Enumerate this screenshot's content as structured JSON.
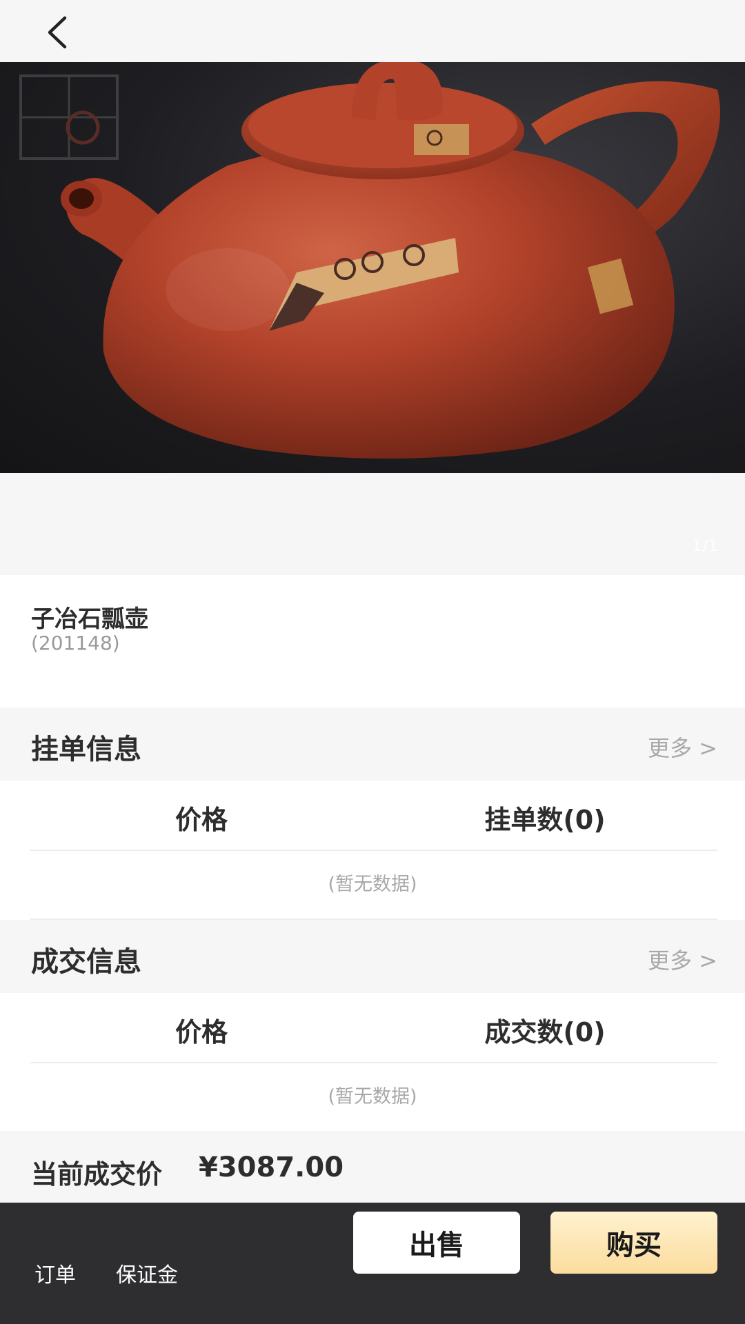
{
  "nav": {
    "back_icon": "chevron-left-icon"
  },
  "gallery": {
    "pager": "1/1",
    "image_subject": "teapot-photo"
  },
  "product": {
    "name": "子冶石瓢壶",
    "code": "(201148)"
  },
  "listing": {
    "title": "挂单信息",
    "more": "更多 >",
    "col_price": "价格",
    "col_count": "挂单数(0)",
    "empty": "(暂无数据)"
  },
  "deals": {
    "title": "成交信息",
    "more": "更多 >",
    "col_price": "价格",
    "col_count": "成交数(0)",
    "empty": "(暂无数据)"
  },
  "current": {
    "label": "当前成交价",
    "value": "¥3087.00"
  },
  "bottom": {
    "orders": "订单",
    "deposit": "保证金",
    "sell": "出售",
    "buy": "购买"
  },
  "colors": {
    "background": "#f6f6f6",
    "bottom_bar": "#2e2e30",
    "buy_button": "#fbdc9d",
    "teapot": "#b4432b"
  }
}
